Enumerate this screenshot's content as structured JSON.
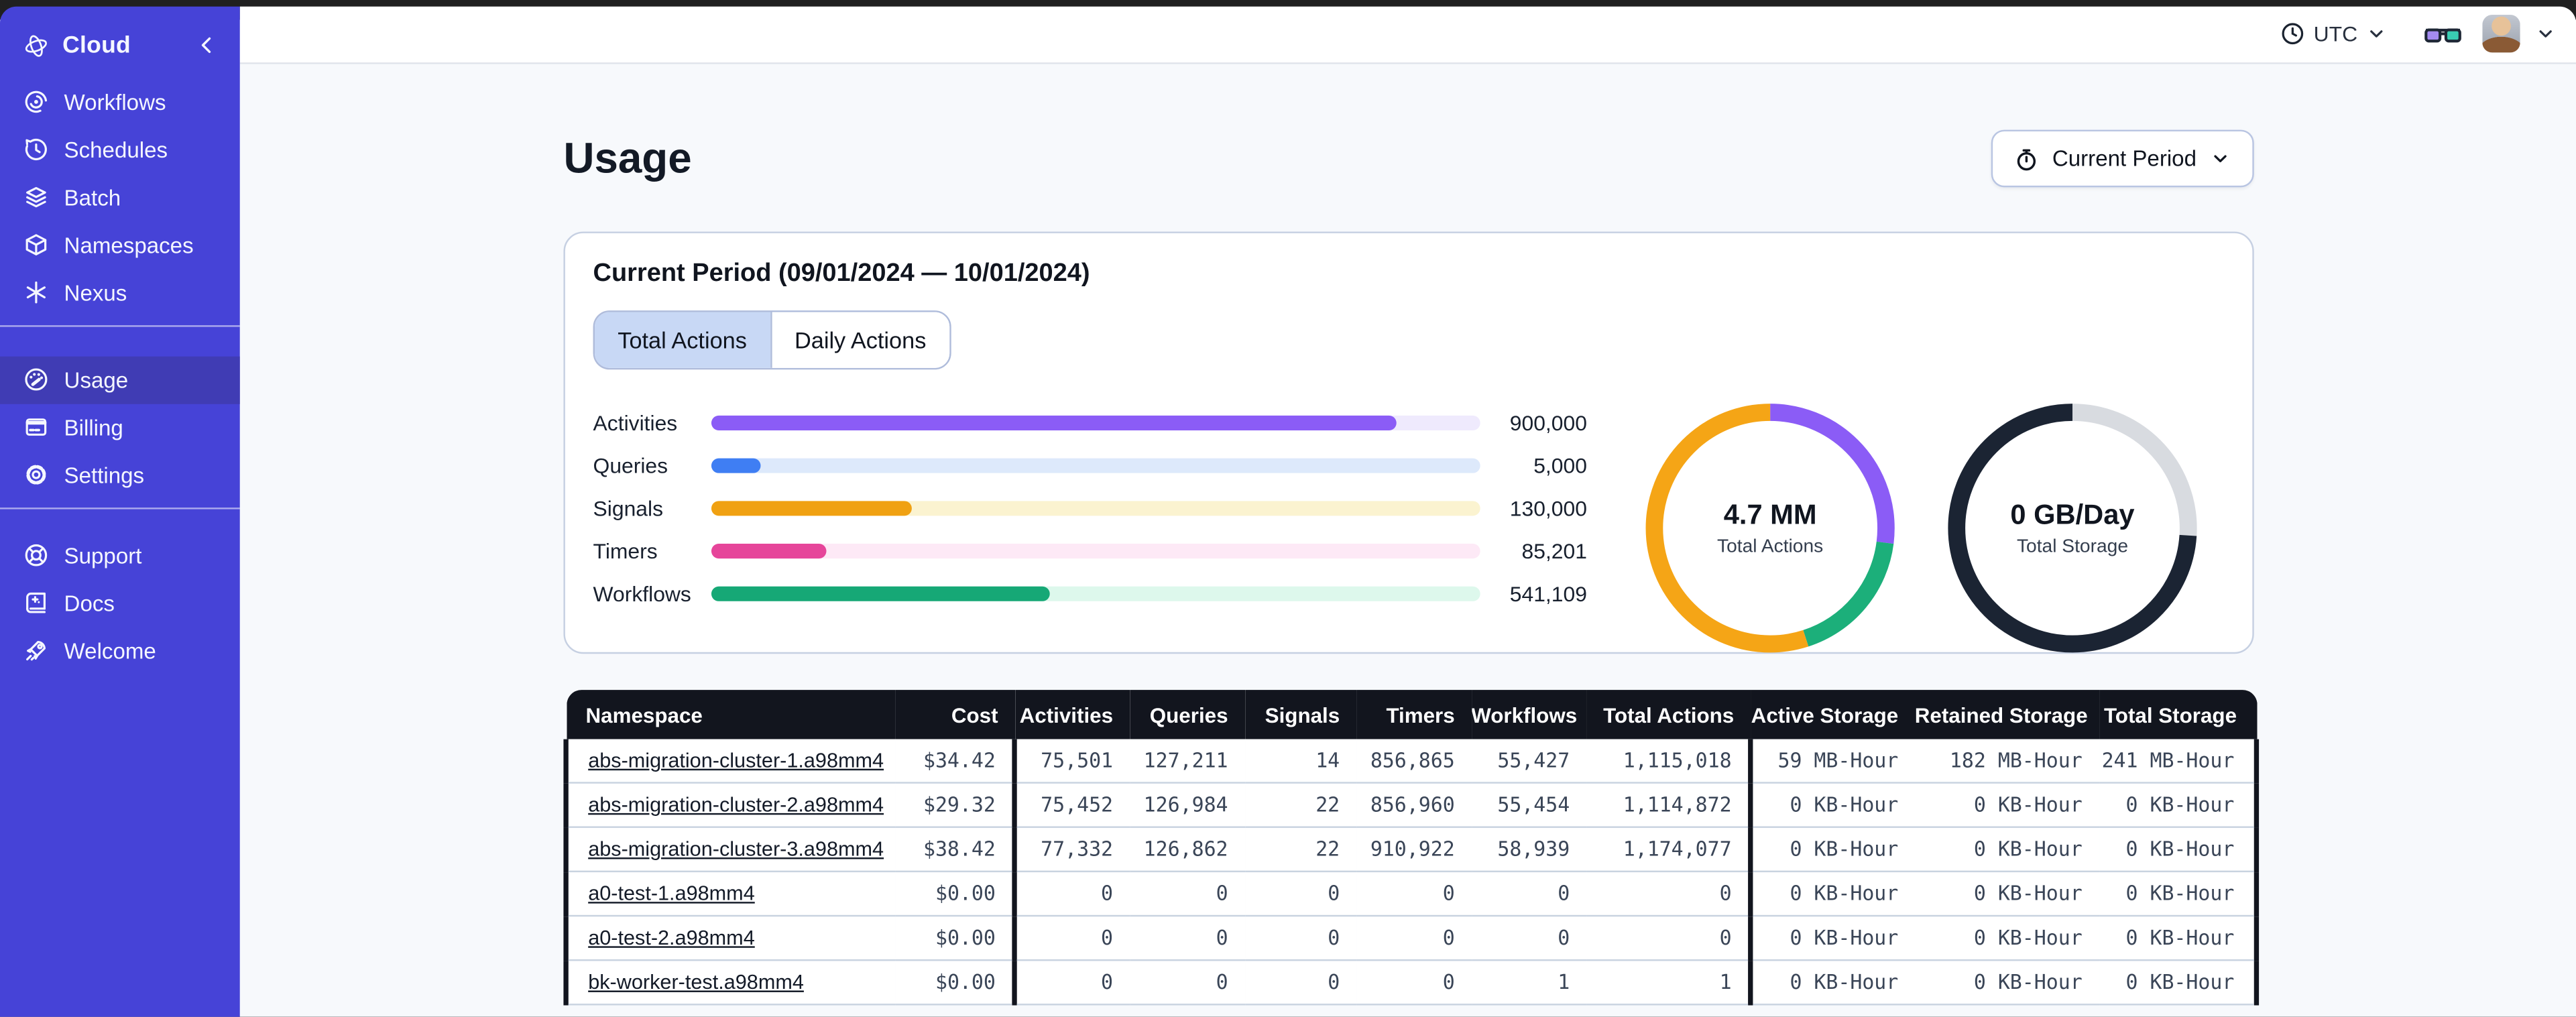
{
  "colors": {
    "sidebar_bg": "#4643D7",
    "sidebar_active_bg": "#403CB4",
    "table_header_bg": "#12151E",
    "selected_tab_bg": "#C8D8F5",
    "panel_border": "#C6D0E2"
  },
  "sidebar": {
    "brand": {
      "label": "Cloud",
      "logo_icon": "temporal-logo",
      "collapse_icon": "chevron-left-icon"
    },
    "sections": [
      {
        "items": [
          {
            "id": "workflows",
            "label": "Workflows",
            "icon": "workflows",
            "active": false
          },
          {
            "id": "schedules",
            "label": "Schedules",
            "icon": "schedules",
            "active": false
          },
          {
            "id": "batch",
            "label": "Batch",
            "icon": "batch",
            "active": false
          },
          {
            "id": "namespaces",
            "label": "Namespaces",
            "icon": "namespaces",
            "active": false
          },
          {
            "id": "nexus",
            "label": "Nexus",
            "icon": "nexus",
            "active": false
          }
        ]
      },
      {
        "items": [
          {
            "id": "usage",
            "label": "Usage",
            "icon": "usage",
            "active": true
          },
          {
            "id": "billing",
            "label": "Billing",
            "icon": "billing",
            "active": false
          },
          {
            "id": "settings",
            "label": "Settings",
            "icon": "settings",
            "active": false
          }
        ]
      },
      {
        "items": [
          {
            "id": "support",
            "label": "Support",
            "icon": "support",
            "active": false
          },
          {
            "id": "docs",
            "label": "Docs",
            "icon": "docs",
            "active": false
          },
          {
            "id": "welcome",
            "label": "Welcome",
            "icon": "welcome",
            "active": false
          }
        ]
      }
    ]
  },
  "topbar": {
    "timezone_label": "UTC",
    "timezone_icon": "clock-icon",
    "glasses_icon": "glasses-icon",
    "avatar": "user-avatar-photo",
    "caret_icon": "chevron-down-icon"
  },
  "page": {
    "title": "Usage",
    "period_selector": {
      "label": "Current Period",
      "icon": "stopwatch-icon"
    }
  },
  "panel": {
    "title": "Current Period (09/01/2024 — 10/01/2024)",
    "tabs": [
      {
        "label": "Total Actions",
        "active": true
      },
      {
        "label": "Daily Actions",
        "active": false
      }
    ]
  },
  "chart_data": [
    {
      "type": "bar",
      "orientation": "horizontal",
      "title": "Current Period (09/01/2024 — 10/01/2024)",
      "categories": [
        "Activities",
        "Queries",
        "Signals",
        "Timers",
        "Workflows"
      ],
      "values": [
        900000,
        5000,
        130000,
        85201,
        541109
      ],
      "display_values": [
        "900,000",
        "5,000",
        "130,000",
        "85,201",
        "541,109"
      ],
      "fill_pct": [
        89,
        6.5,
        26,
        15,
        44
      ],
      "colors": [
        "#8B5CF6",
        "#3F7EF3",
        "#F0A112",
        "#E6459A",
        "#16A876"
      ],
      "track_colors": [
        "#EFEAFD",
        "#DDE9FB",
        "#FBF3D0",
        "#FDE9F6",
        "#DDF8EC"
      ],
      "grid": false,
      "legend": false
    },
    {
      "type": "pie",
      "subtype": "donut",
      "center_value": "4.7 MM",
      "center_label": "Total Actions",
      "segments": [
        {
          "name": "activities",
          "color": "#8B5CF6",
          "pct": 27
        },
        {
          "name": "workflows",
          "color": "#1CAF7A",
          "pct": 18
        },
        {
          "name": "other",
          "color": "#F5A516",
          "pct": 55
        }
      ]
    },
    {
      "type": "pie",
      "subtype": "donut",
      "center_value": "0 GB/Day",
      "center_label": "Total Storage",
      "segments": [
        {
          "name": "remaining",
          "color": "#D8DBE0",
          "pct": 26
        },
        {
          "name": "used",
          "color": "#1B2433",
          "pct": 74
        }
      ]
    }
  ],
  "table": {
    "columns": [
      {
        "id": "namespace",
        "label": "Namespace",
        "align": "left"
      },
      {
        "id": "cost",
        "label": "Cost",
        "align": "right"
      },
      {
        "id": "activities",
        "label": "Activities",
        "align": "right",
        "group_start": true
      },
      {
        "id": "queries",
        "label": "Queries",
        "align": "right"
      },
      {
        "id": "signals",
        "label": "Signals",
        "align": "right"
      },
      {
        "id": "timers",
        "label": "Timers",
        "align": "right"
      },
      {
        "id": "workflows",
        "label": "Workflows",
        "align": "right"
      },
      {
        "id": "total_actions",
        "label": "Total Actions",
        "align": "right"
      },
      {
        "id": "active_storage",
        "label": "Active Storage",
        "align": "right",
        "group_start": true
      },
      {
        "id": "retained_storage",
        "label": "Retained Storage",
        "align": "right"
      },
      {
        "id": "total_storage",
        "label": "Total Storage",
        "align": "right"
      }
    ],
    "rows": [
      [
        "abs-migration-cluster-1.a98mm4",
        "$34.42",
        "75,501",
        "127,211",
        "14",
        "856,865",
        "55,427",
        "1,115,018",
        "59 MB-Hour",
        "182 MB-Hour",
        "241 MB-Hour"
      ],
      [
        "abs-migration-cluster-2.a98mm4",
        "$29.32",
        "75,452",
        "126,984",
        "22",
        "856,960",
        "55,454",
        "1,114,872",
        "0 KB-Hour",
        "0 KB-Hour",
        "0 KB-Hour"
      ],
      [
        "abs-migration-cluster-3.a98mm4",
        "$38.42",
        "77,332",
        "126,862",
        "22",
        "910,922",
        "58,939",
        "1,174,077",
        "0 KB-Hour",
        "0 KB-Hour",
        "0 KB-Hour"
      ],
      [
        "a0-test-1.a98mm4",
        "$0.00",
        "0",
        "0",
        "0",
        "0",
        "0",
        "0",
        "0 KB-Hour",
        "0 KB-Hour",
        "0 KB-Hour"
      ],
      [
        "a0-test-2.a98mm4",
        "$0.00",
        "0",
        "0",
        "0",
        "0",
        "0",
        "0",
        "0 KB-Hour",
        "0 KB-Hour",
        "0 KB-Hour"
      ],
      [
        "bk-worker-test.a98mm4",
        "$0.00",
        "0",
        "0",
        "0",
        "0",
        "1",
        "1",
        "0 KB-Hour",
        "0 KB-Hour",
        "0 KB-Hour"
      ]
    ]
  }
}
